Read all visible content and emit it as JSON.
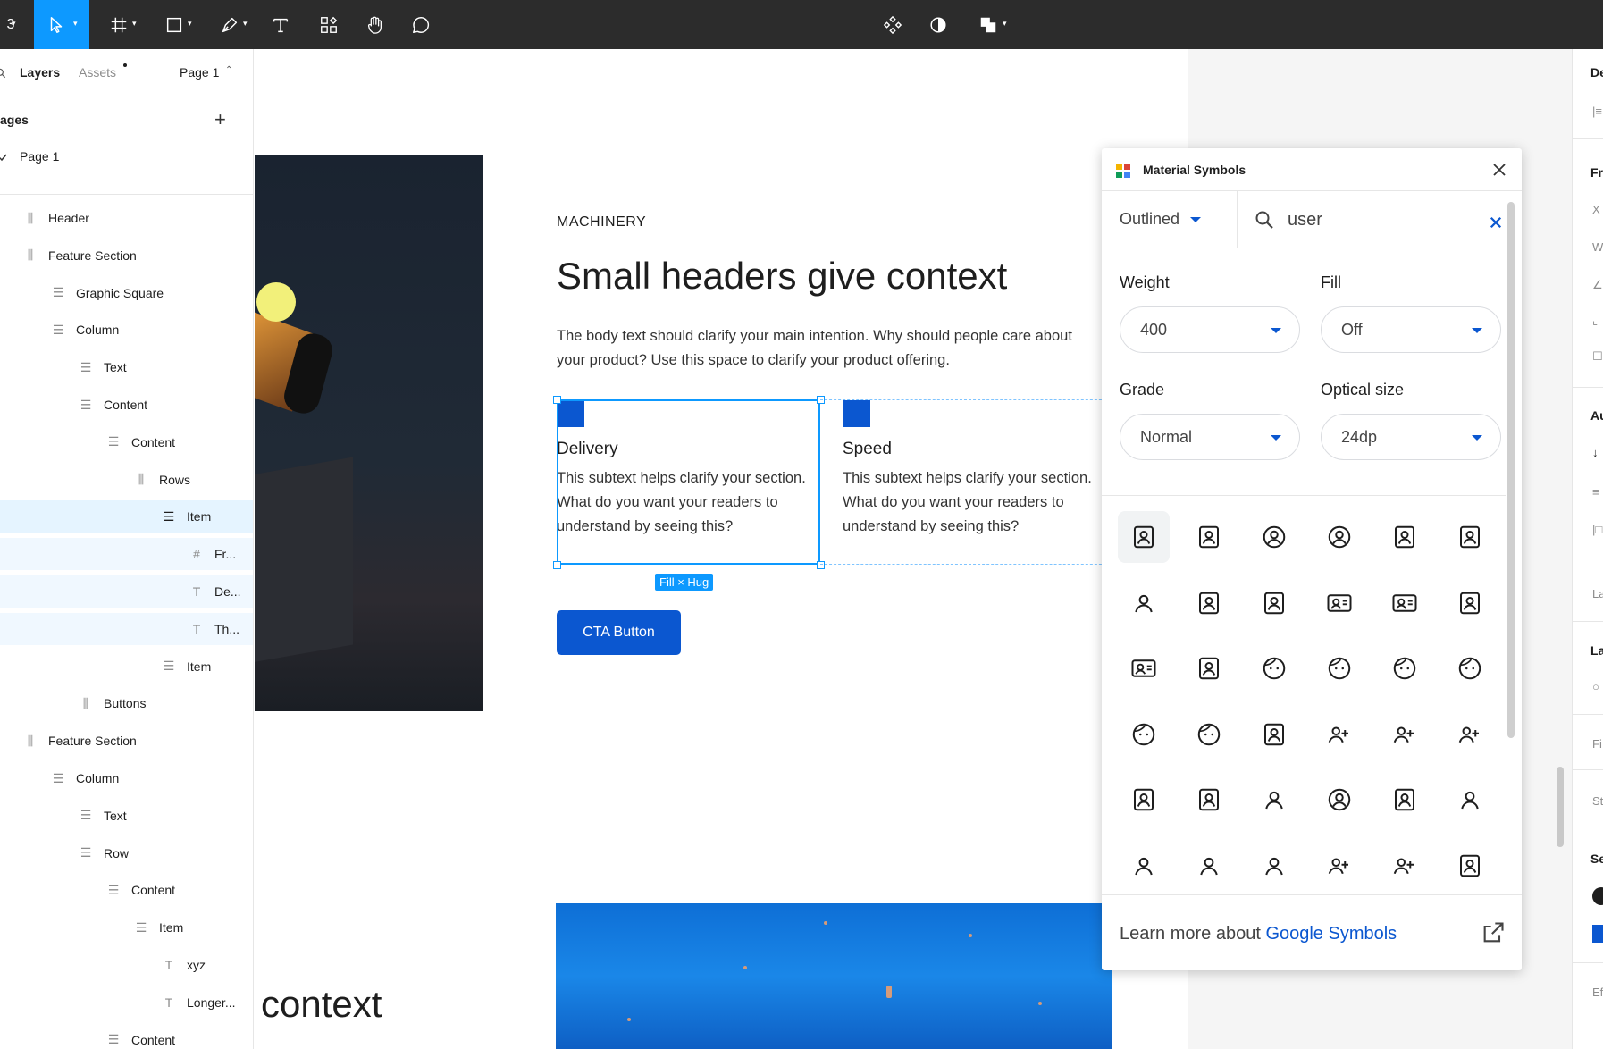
{
  "toolbar": {
    "menu_label": "3",
    "tools": [
      "move-tool",
      "frame-tool",
      "shape-tool",
      "pen-tool",
      "text-tool",
      "resources-tool",
      "hand-tool",
      "comment-tool"
    ],
    "center_tools": [
      "components",
      "theme",
      "boolean"
    ]
  },
  "left_panel": {
    "tabs": {
      "layers": "Layers",
      "assets": "Assets"
    },
    "page_selector": "Page 1",
    "pages_title": "ages",
    "current_page": "Page 1",
    "layers": [
      {
        "label": "Header",
        "type": "column",
        "depth": 0
      },
      {
        "label": "Feature Section",
        "type": "column",
        "depth": 0
      },
      {
        "label": "Graphic Square",
        "type": "row",
        "depth": 1
      },
      {
        "label": "Column",
        "type": "row",
        "depth": 1
      },
      {
        "label": "Text",
        "type": "row",
        "depth": 2
      },
      {
        "label": "Content",
        "type": "row",
        "depth": 2
      },
      {
        "label": "Content",
        "type": "row",
        "depth": 3
      },
      {
        "label": "Rows",
        "type": "column",
        "depth": 4
      },
      {
        "label": "Item",
        "type": "row",
        "depth": 5,
        "state": "selected"
      },
      {
        "label": "Fr...",
        "type": "frame",
        "depth": 6,
        "state": "child"
      },
      {
        "label": "De...",
        "type": "text",
        "depth": 6,
        "state": "child"
      },
      {
        "label": "Th...",
        "type": "text",
        "depth": 6,
        "state": "child"
      },
      {
        "label": "Item",
        "type": "row",
        "depth": 5
      },
      {
        "label": "Buttons",
        "type": "column",
        "depth": 2
      },
      {
        "label": "Feature Section",
        "type": "column",
        "depth": 0
      },
      {
        "label": "Column",
        "type": "row",
        "depth": 1
      },
      {
        "label": "Text",
        "type": "row",
        "depth": 2
      },
      {
        "label": "Row",
        "type": "row",
        "depth": 2
      },
      {
        "label": "Content",
        "type": "row",
        "depth": 3
      },
      {
        "label": "Item",
        "type": "row",
        "depth": 4
      },
      {
        "label": "xyz",
        "type": "text",
        "depth": 5
      },
      {
        "label": "Longer...",
        "type": "text",
        "depth": 5
      },
      {
        "label": "Content",
        "type": "row",
        "depth": 3
      }
    ]
  },
  "canvas": {
    "eyebrow": "MACHINERY",
    "headline": "Small headers give context",
    "body": "The body text should clarify your main intention. Why should people care about your product? Use this space to clarify your product offering.",
    "features": [
      {
        "title": "Delivery",
        "text": "This subtext helps clarify your section. What do you want your readers to understand by seeing this?"
      },
      {
        "title": "Speed",
        "text": "This subtext helps clarify your section. What do you want your readers to understand by seeing this?"
      }
    ],
    "size_badge": "Fill × Hug",
    "cta_label": "CTA Button",
    "bottom_text": "context"
  },
  "plugin": {
    "title": "Material Symbols",
    "style": "Outlined",
    "search_value": "user",
    "options": {
      "weight_label": "Weight",
      "weight_value": "400",
      "fill_label": "Fill",
      "fill_value": "Off",
      "grade_label": "Grade",
      "grade_value": "Normal",
      "optical_label": "Optical size",
      "optical_value": "24dp"
    },
    "icons": [
      "account-box-edit-icon",
      "account-box-icon",
      "account-circle-icon",
      "no-accounts-icon",
      "shield-person-icon",
      "badge-icon",
      "person-raised-hand-icon",
      "id-card-icon",
      "contact-calendar-icon",
      "contact-emergency-icon",
      "contact-mail-icon",
      "contact-page-icon",
      "contacts-icon",
      "assignment-ind-icon",
      "face-icon",
      "face-2-icon",
      "face-3-icon",
      "face-4-icon",
      "face-5-icon",
      "face-6-icon",
      "folder-shared-icon",
      "group-icon",
      "group-add-icon",
      "group-remove-icon",
      "home-person-icon",
      "home-account-icon",
      "manage-accounts-icon",
      "person-off-icon",
      "perm-contact-calendar-icon",
      "person-icon",
      "person-outline-icon",
      "person-2-icon",
      "person-3-icon",
      "person-add-icon",
      "person-add-disabled-icon",
      "person-pin-icon"
    ],
    "footer_text": "Learn more about ",
    "footer_link": "Google Symbols"
  },
  "right_panel": {
    "labels": [
      "De",
      "Fr",
      "X",
      "W",
      "Au",
      "La",
      "La",
      "Fi",
      "St",
      "Se",
      "Ef"
    ]
  },
  "colors": {
    "accent": "#0d99ff",
    "brand_blue": "#0b57d0",
    "toolbar_bg": "#2c2c2c"
  }
}
